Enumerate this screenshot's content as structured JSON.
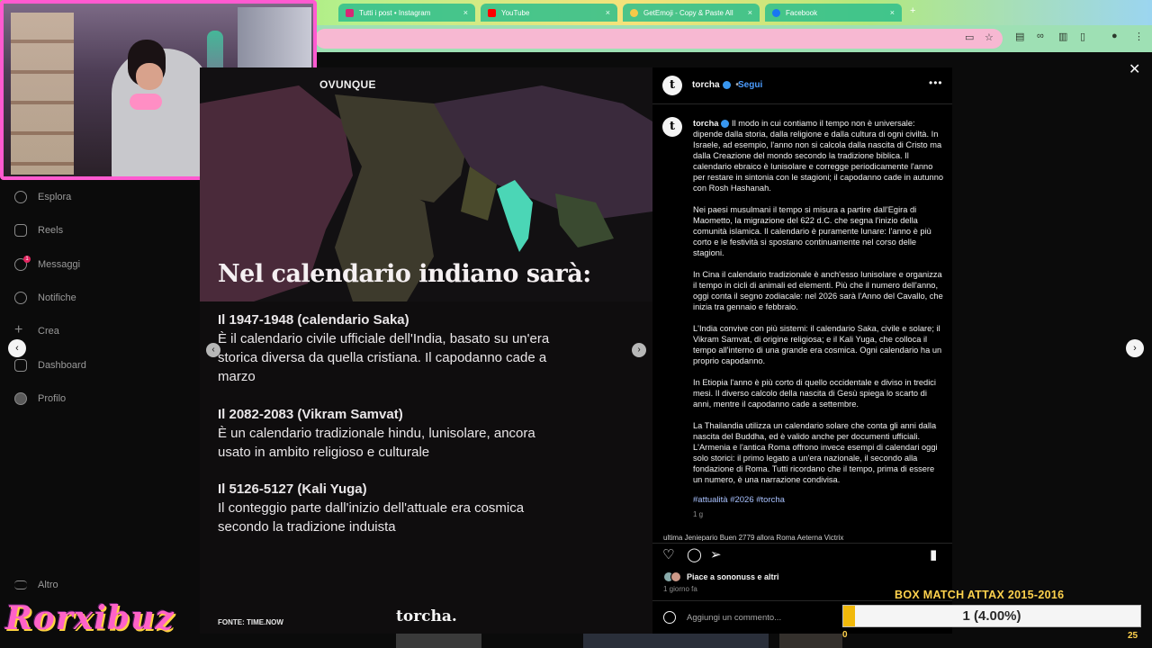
{
  "browser": {
    "tabs": [
      {
        "label": "Tutti i post • Instagram",
        "favicon_color": "#d62976"
      },
      {
        "label": "YouTube",
        "favicon_color": "#ff0000"
      },
      {
        "label": "GetEmoji - Copy & Paste All",
        "favicon_color": "#f7c948"
      },
      {
        "label": "Facebook",
        "favicon_color": "#1877f2"
      }
    ],
    "close_glyph": "×",
    "new_tab_glyph": "+"
  },
  "sidebar": {
    "items": [
      {
        "label": "Esplora",
        "icon": "compass-icon"
      },
      {
        "label": "Reels",
        "icon": "reels-icon"
      },
      {
        "label": "Messaggi",
        "icon": "messages-icon",
        "badge": "1"
      },
      {
        "label": "Notifiche",
        "icon": "heart-icon"
      },
      {
        "label": "Crea",
        "icon": "plus-icon"
      },
      {
        "label": "Dashboard",
        "icon": "dashboard-icon"
      },
      {
        "label": "Profilo",
        "icon": "profile-icon"
      }
    ],
    "more_label": "Altro"
  },
  "post": {
    "brand_top": "OVUNQUE",
    "headline": "Nel calendario indiano sarà:",
    "sections": [
      {
        "title": "Il 1947-1948 (calendario Saka)",
        "body": "È il calendario civile ufficiale dell'India, basato su un'era storica diversa da quella cristiana. Il capodanno cade a marzo"
      },
      {
        "title": "Il 2082-2083 (Vikram Samvat)",
        "body": "È un calendario tradizionale hindu, lunisolare, ancora usato in ambito religioso e culturale"
      },
      {
        "title": "Il 5126-5127 (Kali Yuga)",
        "body": "Il conteggio parte dall'inizio dell'attuale era cosmica secondo la tradizione induista"
      }
    ],
    "source": "FONTE: TIME.NOW",
    "logo": "torcha."
  },
  "info": {
    "avatar_letter": "t",
    "username": "torcha",
    "separator": "•",
    "follow_label": "Segui",
    "more_glyph": "•••",
    "caption": [
      "Il modo in cui contiamo il tempo non è universale: dipende dalla storia, dalla religione e dalla cultura di ogni civiltà. In Israele, ad esempio, l'anno non si calcola dalla nascita di Cristo ma dalla Creazione del mondo secondo la tradizione biblica. Il calendario ebraico è lunisolare e corregge periodicamente l'anno per restare in sintonia con le stagioni; il capodanno cade in autunno con Rosh Hashanah.",
      "Nei paesi musulmani il tempo si misura a partire dall'Egira di Maometto, la migrazione del 622 d.C. che segna l'inizio della comunità islamica. Il calendario è puramente lunare: l'anno è più corto e le festività si spostano continuamente nel corso delle stagioni.",
      "In Cina il calendario tradizionale è anch'esso lunisolare e organizza il tempo in cicli di animali ed elementi. Più che il numero dell'anno, oggi conta il segno zodiacale: nel 2026 sarà l'Anno del Cavallo, che inizia tra gennaio e febbraio.",
      "L'India convive con più sistemi: il calendario Saka, civile e solare; il Vikram Samvat, di origine religiosa; e il Kali Yuga, che colloca il tempo all'interno di una grande era cosmica. Ogni calendario ha un proprio capodanno.",
      "In Etiopia l'anno è più corto di quello occidentale e diviso in tredici mesi. Il diverso calcolo della nascita di Gesù spiega lo scarto di anni, mentre il capodanno cade a settembre.",
      "La Thailandia utilizza un calendario solare che conta gli anni dalla nascita del Buddha, ed è valido anche per documenti ufficiali. L'Armenia e l'antica Roma offrono invece esempi di calendari oggi solo storici: il primo legato a un'era nazionale, il secondo alla fondazione di Roma. Tutti ricordano che il tempo, prima di essere un numero, è una narrazione condivisa."
    ],
    "hashtags": "#attualità #2026 #torcha",
    "age": "1 g",
    "cut_comment": "ultima Jeniepario Buen 2779 allora Roma Aeterna Victrix",
    "likes_text": "Piace a sononuss e altri",
    "date": "1 giorno fa",
    "comment_placeholder": "Aggiungi un commento..."
  },
  "overlay": {
    "signature": "Rorxibuz",
    "box_title": "BOX MATCH ATTAX 2015-2016",
    "progress_text": "1 (4.00%)",
    "progress_fraction": 0.04,
    "progress_min": "0",
    "progress_max": "25"
  },
  "colors": {
    "accent_blue": "#4b9cff",
    "verified": "#3897f0",
    "overlay_yellow": "#ffd24d",
    "signature_pink": "#ff62c8"
  }
}
